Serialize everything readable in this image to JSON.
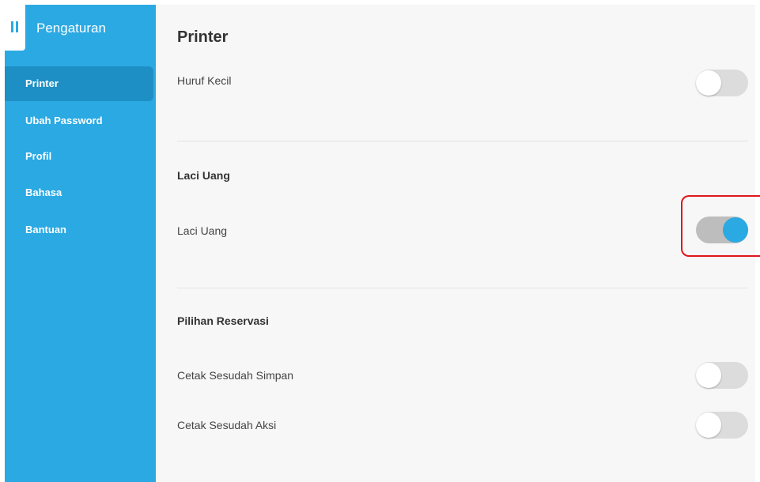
{
  "sidebar": {
    "title": "Pengaturan",
    "items": [
      {
        "label": "Printer",
        "active": true
      },
      {
        "label": "Ubah Password"
      },
      {
        "label": "Profil"
      },
      {
        "label": "Bahasa"
      },
      {
        "label": "Bantuan"
      }
    ]
  },
  "main": {
    "title": "Printer",
    "settings": [
      {
        "label": "Huruf Kecil",
        "on": false
      },
      {
        "section": "Laci Uang"
      },
      {
        "label": "Laci Uang",
        "on": true
      },
      {
        "section": "Pilihan Reservasi"
      },
      {
        "label": "Cetak Sesudah Simpan",
        "on": false
      },
      {
        "label": "Cetak Sesudah Aksi",
        "on": false
      }
    ]
  },
  "colors": {
    "sidebar": "#2aa9e3",
    "sidebar_active": "#1e8fc4",
    "toggle_on": "#2aa9e3",
    "highlight": "#e0161b"
  }
}
